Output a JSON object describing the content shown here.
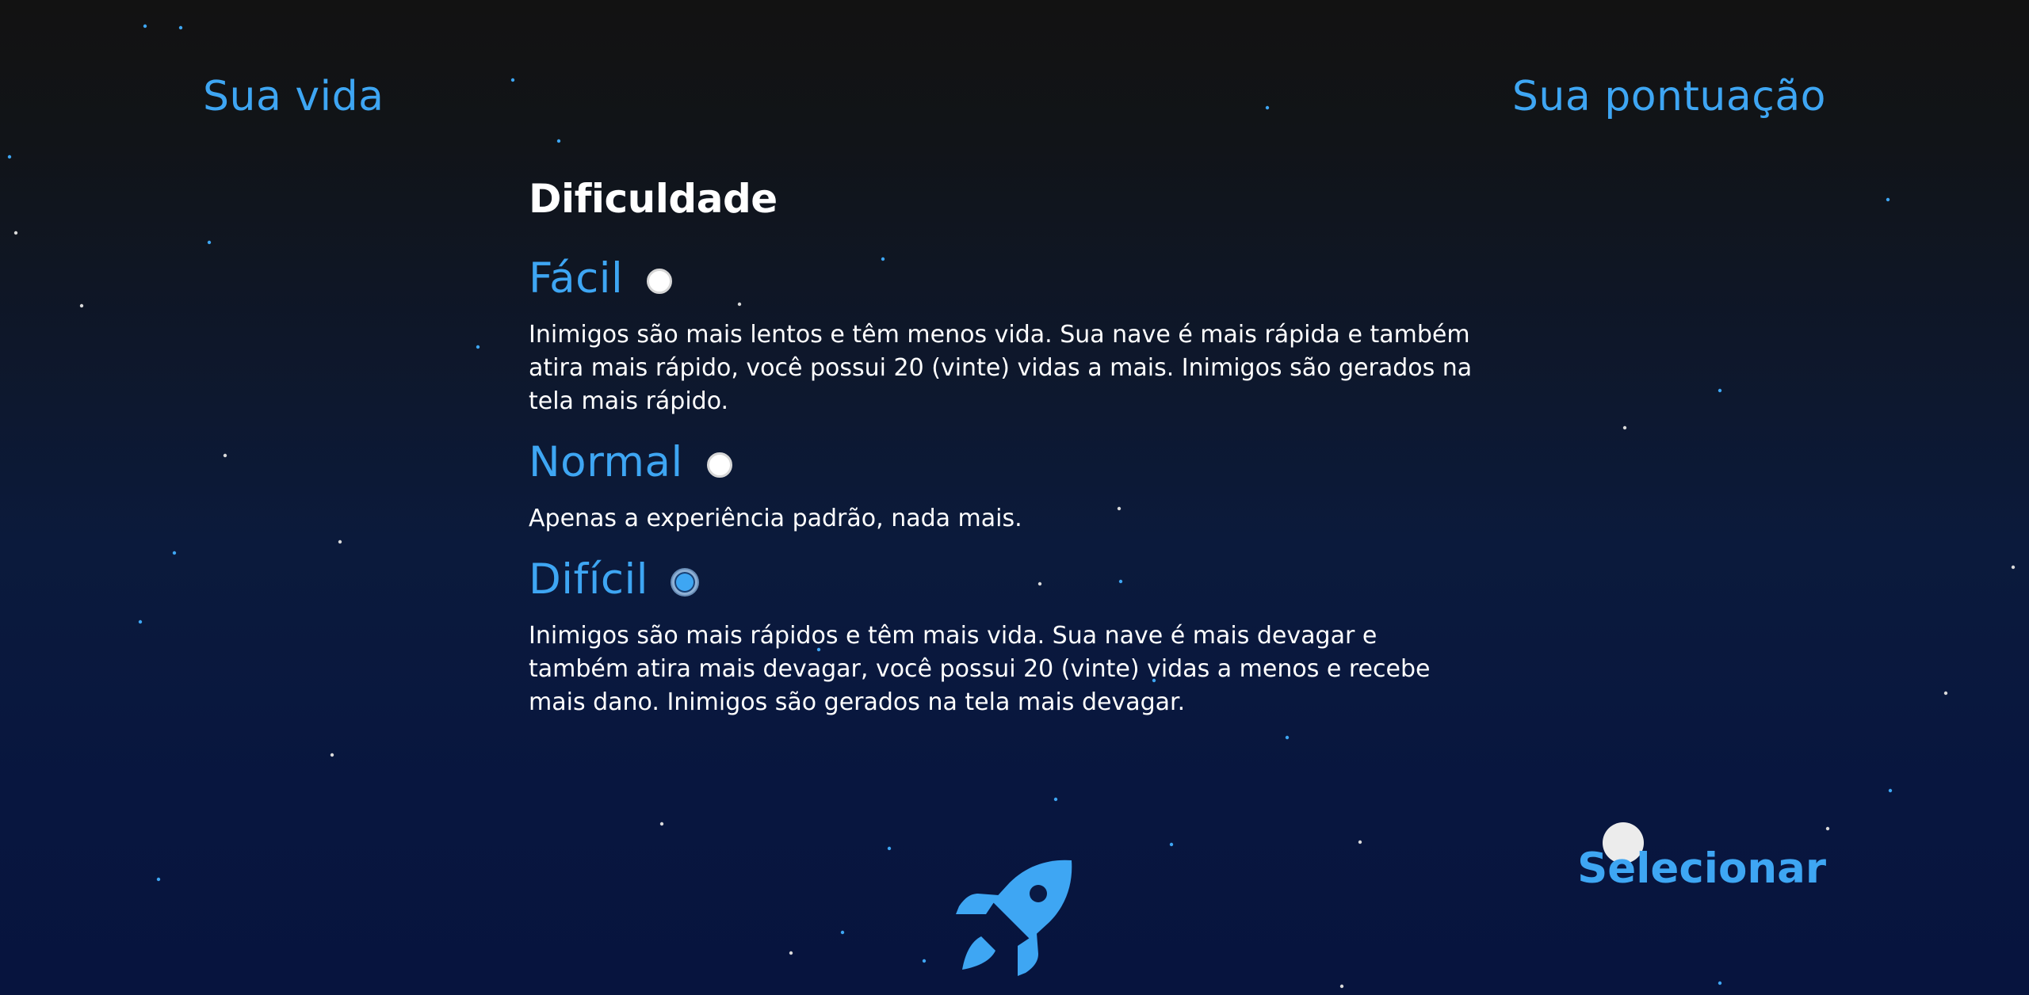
{
  "hud": {
    "life_label": "Sua vida",
    "score_label": "Sua pontuação"
  },
  "difficulty": {
    "title": "Dificuldade",
    "selected": "dificil",
    "options": [
      {
        "id": "facil",
        "label": "Fácil",
        "checked": false,
        "description": "Inimigos são mais lentos e têm menos vida. Sua nave é mais rápida e também atira mais rápido, você possui 20 (vinte) vidas a mais. Inimigos são gerados na tela mais rápido."
      },
      {
        "id": "normal",
        "label": "Normal",
        "checked": false,
        "description": "Apenas a experiência padrão, nada mais."
      },
      {
        "id": "dificil",
        "label": "Difícil",
        "checked": true,
        "description": "Inimigos são mais rápidos e têm mais vida. Sua nave é mais devagar e também atira mais devagar, você possui 20 (vinte) vidas a menos e recebe mais dano. Inimigos são gerados na tela mais devagar."
      }
    ]
  },
  "actions": {
    "select_label": "Selecionar"
  },
  "icons": {
    "ship": "rocket-icon",
    "cursor": "cursor-icon"
  },
  "colors": {
    "accent": "#3ea6f3",
    "text": "#ffffff",
    "star_white": "#d9d9d9",
    "star_blue": "#3ea6f3"
  }
}
